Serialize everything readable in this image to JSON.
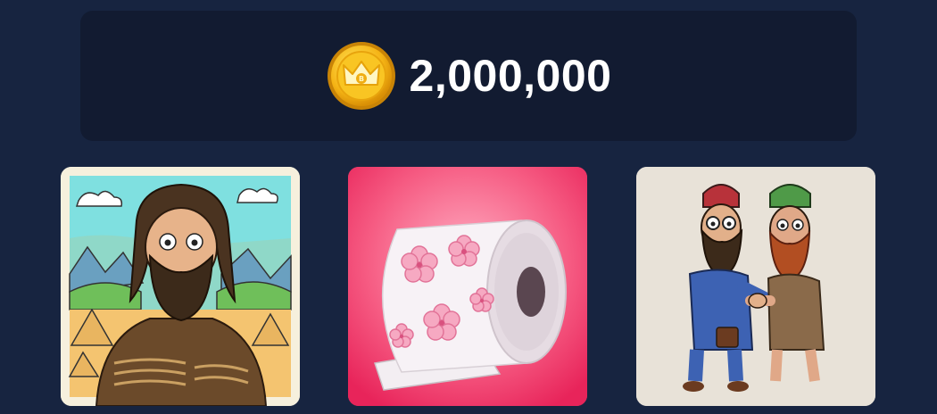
{
  "balance": {
    "amount": "2,000,000",
    "coin_icon": "crown-coin-icon",
    "coin_color": "#f5b415"
  },
  "items": [
    {
      "id": "card-1",
      "image": "bearded-man-mona-lisa-pyramids",
      "background": "#f6f0dd"
    },
    {
      "id": "card-2",
      "image": "cherry-blossom-toilet-paper-roll",
      "background": "#f2456f"
    },
    {
      "id": "card-3",
      "image": "two-bearded-men-handshake",
      "background": "#e8e2d8"
    }
  ]
}
